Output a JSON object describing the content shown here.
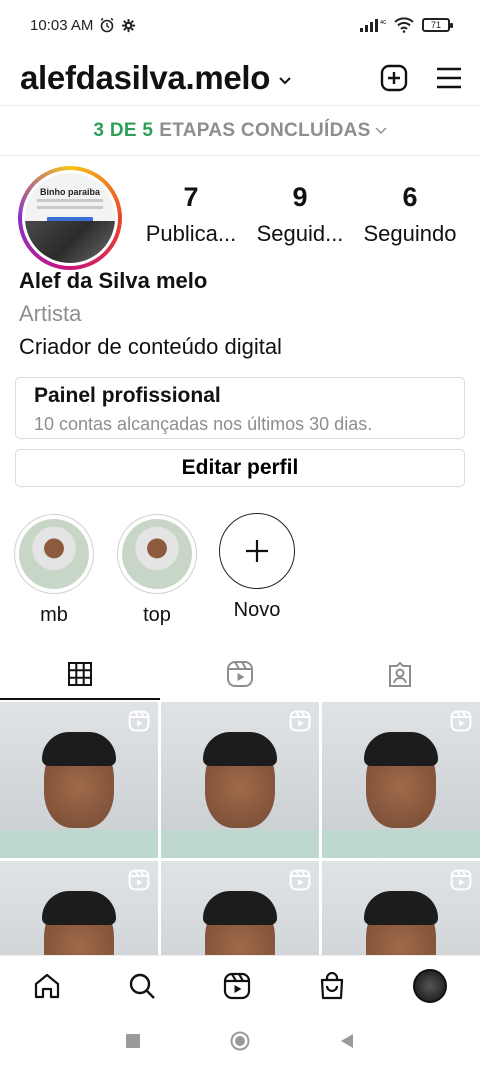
{
  "status_bar": {
    "time": "10:03 AM",
    "battery": "71"
  },
  "header": {
    "username": "alefdasilva.melo"
  },
  "steps": {
    "done": "3 DE 5",
    "label": "ETAPAS CONCLUÍDAS"
  },
  "profile": {
    "avatar_text": "Binho paraiba",
    "stats": [
      {
        "value": "7",
        "label": "Publica..."
      },
      {
        "value": "9",
        "label": "Seguid..."
      },
      {
        "value": "6",
        "label": "Seguindo"
      }
    ],
    "name": "Alef da Silva melo",
    "category": "Artista",
    "bio": "Criador de conteúdo digital"
  },
  "professional_panel": {
    "title": "Painel profissional",
    "subtitle": "10 contas alcançadas nos últimos 30 dias."
  },
  "edit_profile_label": "Editar perfil",
  "highlights": [
    {
      "label": "mb"
    },
    {
      "label": "top"
    },
    {
      "label": "Novo"
    }
  ],
  "tabs": [
    {
      "icon": "grid-icon",
      "active": true
    },
    {
      "icon": "reels-icon",
      "active": false
    },
    {
      "icon": "tagged-icon",
      "active": false
    }
  ],
  "grid": {
    "post_count_visible": 6
  },
  "bottom_nav": [
    "home-icon",
    "search-icon",
    "reels-icon",
    "shop-icon",
    "profile-avatar"
  ],
  "colors": {
    "accent_green": "#2f9e57",
    "muted": "#8e8e8e",
    "border": "#dbdbdb"
  }
}
